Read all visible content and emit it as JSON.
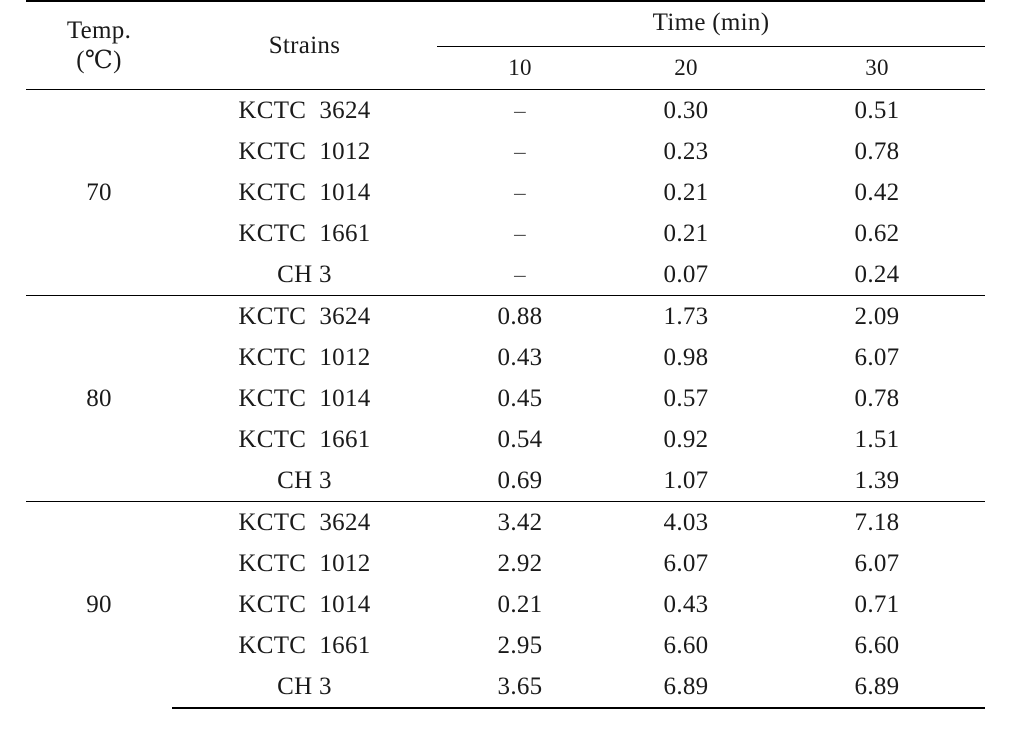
{
  "table": {
    "headers": {
      "temp_line1": "Temp.",
      "temp_line2": "(℃)",
      "strains": "Strains",
      "time_group": "Time (min)",
      "time_10": "10",
      "time_20": "20",
      "time_30": "30"
    },
    "blocks": [
      {
        "temperature": "70",
        "rows": [
          {
            "strain": "KCTC  3624",
            "t10": "–",
            "t20": "0.30",
            "t30": "0.51"
          },
          {
            "strain": "KCTC  1012",
            "t10": "–",
            "t20": "0.23",
            "t30": "0.78"
          },
          {
            "strain": "KCTC  1014",
            "t10": "–",
            "t20": "0.21",
            "t30": "0.42"
          },
          {
            "strain": "KCTC  1661",
            "t10": "–",
            "t20": "0.21",
            "t30": "0.62"
          },
          {
            "strain": "CH 3",
            "t10": "–",
            "t20": "0.07",
            "t30": "0.24"
          }
        ]
      },
      {
        "temperature": "80",
        "rows": [
          {
            "strain": "KCTC  3624",
            "t10": "0.88",
            "t20": "1.73",
            "t30": "2.09"
          },
          {
            "strain": "KCTC  1012",
            "t10": "0.43",
            "t20": "0.98",
            "t30": "6.07"
          },
          {
            "strain": "KCTC  1014",
            "t10": "0.45",
            "t20": "0.57",
            "t30": "0.78"
          },
          {
            "strain": "KCTC  1661",
            "t10": "0.54",
            "t20": "0.92",
            "t30": "1.51"
          },
          {
            "strain": "CH 3",
            "t10": "0.69",
            "t20": "1.07",
            "t30": "1.39"
          }
        ]
      },
      {
        "temperature": "90",
        "rows": [
          {
            "strain": "KCTC  3624",
            "t10": "3.42",
            "t20": "4.03",
            "t30": "7.18"
          },
          {
            "strain": "KCTC  1012",
            "t10": "2.92",
            "t20": "6.07",
            "t30": "6.07"
          },
          {
            "strain": "KCTC  1014",
            "t10": "0.21",
            "t20": "0.43",
            "t30": "0.71"
          },
          {
            "strain": "KCTC  1661",
            "t10": "2.95",
            "t20": "6.60",
            "t30": "6.60"
          },
          {
            "strain": "CH 3",
            "t10": "3.65",
            "t20": "6.89",
            "t30": "6.89"
          }
        ]
      }
    ]
  },
  "chart_data": {
    "type": "table",
    "title": "",
    "columns": [
      "Temp. (℃)",
      "Strains",
      "10",
      "20",
      "30"
    ],
    "column_group": "Time (min)",
    "rows": [
      [
        "70",
        "KCTC 3624",
        "–",
        "0.30",
        "0.51"
      ],
      [
        "70",
        "KCTC 1012",
        "–",
        "0.23",
        "0.78"
      ],
      [
        "70",
        "KCTC 1014",
        "–",
        "0.21",
        "0.42"
      ],
      [
        "70",
        "KCTC 1661",
        "–",
        "0.21",
        "0.62"
      ],
      [
        "70",
        "CH 3",
        "–",
        "0.07",
        "0.24"
      ],
      [
        "80",
        "KCTC 3624",
        "0.88",
        "1.73",
        "2.09"
      ],
      [
        "80",
        "KCTC 1012",
        "0.43",
        "0.98",
        "6.07"
      ],
      [
        "80",
        "KCTC 1014",
        "0.45",
        "0.57",
        "0.78"
      ],
      [
        "80",
        "KCTC 1661",
        "0.54",
        "0.92",
        "1.51"
      ],
      [
        "80",
        "CH 3",
        "0.69",
        "1.07",
        "1.39"
      ],
      [
        "90",
        "KCTC 3624",
        "3.42",
        "4.03",
        "7.18"
      ],
      [
        "90",
        "KCTC 1012",
        "2.92",
        "6.07",
        "6.07"
      ],
      [
        "90",
        "KCTC 1014",
        "0.21",
        "0.43",
        "0.71"
      ],
      [
        "90",
        "KCTC 1661",
        "2.95",
        "6.60",
        "6.60"
      ],
      [
        "90",
        "CH 3",
        "3.65",
        "6.89",
        "6.89"
      ]
    ]
  }
}
